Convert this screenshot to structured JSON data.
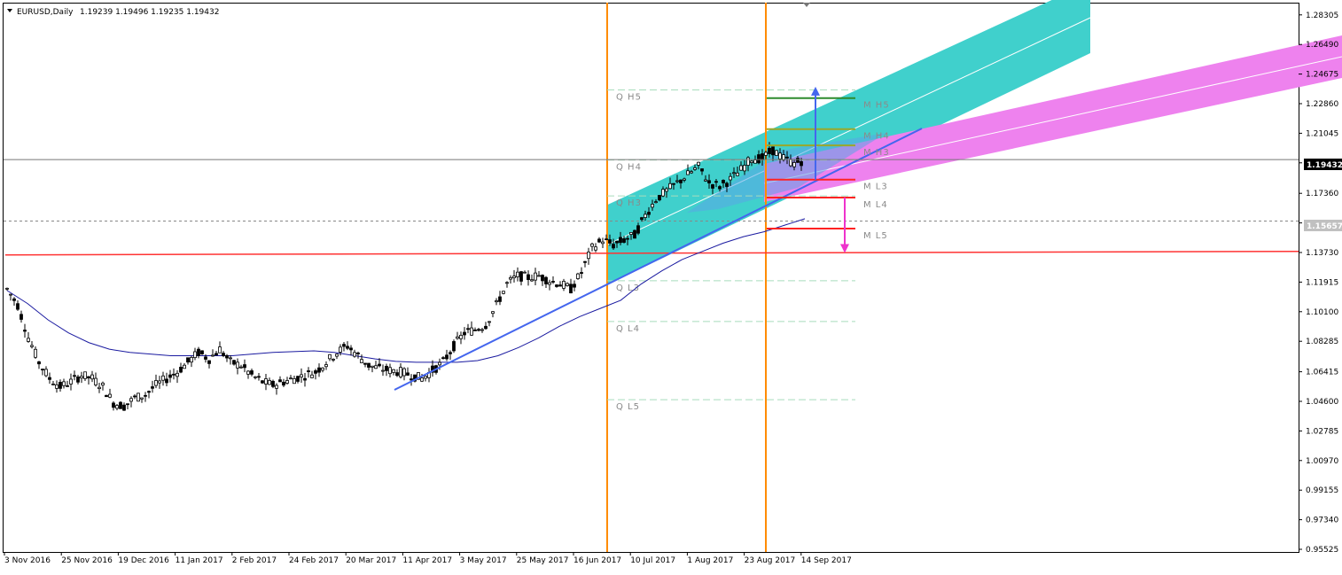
{
  "header": {
    "symbol_label": "EURUSD,Daily",
    "ohlc": "1.19239 1.19496 1.19235 1.19432"
  },
  "price_tags": {
    "current": "1.19432",
    "level2": "1.15657"
  },
  "colors": {
    "bull_channel": "#40d0cc",
    "bear_channel": "#ee82ee",
    "trendline": "#4466ee",
    "moving_average": "#1a1aa0",
    "vertical_markers": "#ff8c00",
    "support_line": "#ff3333",
    "target_up": "#4466ee",
    "target_down": "#ee33cc",
    "m_green": "#2e8b2e",
    "m_olive": "#9aa82a",
    "m_red": "#ff2222",
    "q_line": "#a8dcbc",
    "candle": "#000000"
  },
  "chart_data": {
    "type": "candlestick",
    "instrument": "EURUSD",
    "timeframe": "Daily",
    "last_ohlc": {
      "open": 1.19239,
      "high": 1.19496,
      "low": 1.19235,
      "close": 1.19432
    },
    "ylim": [
      0.95525,
      1.29055
    ],
    "y_ticks": [
      "1.28305",
      "1.26490",
      "1.24675",
      "1.22860",
      "1.21045",
      "1.19230",
      "1.17360",
      "1.15545",
      "1.13730",
      "1.11915",
      "1.10100",
      "1.08285",
      "1.06415",
      "1.04600",
      "1.02785",
      "1.00970",
      "0.99155",
      "0.97340",
      "0.95525"
    ],
    "x_ticks": [
      "3 Nov 2016",
      "25 Nov 2016",
      "19 Dec 2016",
      "11 Jan 2017",
      "2 Feb 2017",
      "24 Feb 2017",
      "20 Mar 2017",
      "11 Apr 2017",
      "3 May 2017",
      "25 May 2017",
      "16 Jun 2017",
      "10 Jul 2017",
      "1 Aug 2017",
      "23 Aug 2017",
      "14 Sep 2017"
    ],
    "price_path": [
      1.115,
      1.105,
      1.085,
      1.07,
      1.06,
      1.055,
      1.058,
      1.062,
      1.06,
      1.055,
      1.045,
      1.043,
      1.048,
      1.05,
      1.056,
      1.06,
      1.064,
      1.07,
      1.076,
      1.072,
      1.078,
      1.07,
      1.068,
      1.062,
      1.058,
      1.056,
      1.058,
      1.06,
      1.062,
      1.064,
      1.07,
      1.076,
      1.08,
      1.074,
      1.068,
      1.066,
      1.065,
      1.064,
      1.062,
      1.06,
      1.065,
      1.07,
      1.08,
      1.088,
      1.09,
      1.093,
      1.105,
      1.118,
      1.123,
      1.122,
      1.123,
      1.12,
      1.118,
      1.115,
      1.125,
      1.14,
      1.145,
      1.142,
      1.145,
      1.148,
      1.16,
      1.17,
      1.175,
      1.18,
      1.185,
      1.19,
      1.18,
      1.178,
      1.182,
      1.188,
      1.195,
      1.195,
      1.2,
      1.195,
      1.192,
      1.1943
    ],
    "moving_average": [
      1.114,
      1.106,
      1.096,
      1.088,
      1.082,
      1.078,
      1.076,
      1.075,
      1.074,
      1.074,
      1.074,
      1.074,
      1.075,
      1.076,
      1.0765,
      1.077,
      1.076,
      1.074,
      1.072,
      1.0705,
      1.07,
      1.07,
      1.07,
      1.071,
      1.074,
      1.079,
      1.085,
      1.092,
      1.098,
      1.103,
      1.108,
      1.118,
      1.126,
      1.133,
      1.138,
      1.143,
      1.147,
      1.15,
      1.154,
      1.158
    ],
    "horizontal_support": 1.1369,
    "trendline": {
      "from": [
        "11 Apr 2017",
        1.051
      ],
      "to": [
        "14 Sep 2017",
        1.217
      ]
    },
    "channels": [
      {
        "name": "ascending-teal",
        "from": [
          "16 Jun 2017",
          1.1475
        ],
        "to": [
          "14 Sep 2017",
          1.26
        ]
      },
      {
        "name": "ascending-magenta",
        "from": [
          "23 Aug 2017",
          1.185
        ],
        "to": [
          "14 Sep 2017",
          1.26
        ]
      }
    ],
    "vertical_markers": [
      "16 Jun 2017",
      "23 Aug 2017"
    ],
    "quarterly_pivots": [
      {
        "label": "Q H5",
        "value": 1.237
      },
      {
        "label": "Q H4",
        "value": 1.194
      },
      {
        "label": "Q H3",
        "value": 1.172
      },
      {
        "label": "Q L3",
        "value": 1.12
      },
      {
        "label": "Q L4",
        "value": 1.095
      },
      {
        "label": "Q L5",
        "value": 1.047
      }
    ],
    "monthly_pivots": [
      {
        "label": "M H5",
        "value": 1.232,
        "color": "green"
      },
      {
        "label": "M H4",
        "value": 1.213,
        "color": "olive"
      },
      {
        "label": "M H3",
        "value": 1.203,
        "color": "olive"
      },
      {
        "label": "M L3",
        "value": 1.182,
        "color": "red"
      },
      {
        "label": "M L4",
        "value": 1.171,
        "color": "red"
      },
      {
        "label": "M L5",
        "value": 1.152,
        "color": "red"
      }
    ],
    "targets": [
      {
        "direction": "up",
        "from": 1.182,
        "to": 1.239
      },
      {
        "direction": "down",
        "from": 1.171,
        "to": 1.137
      }
    ]
  }
}
